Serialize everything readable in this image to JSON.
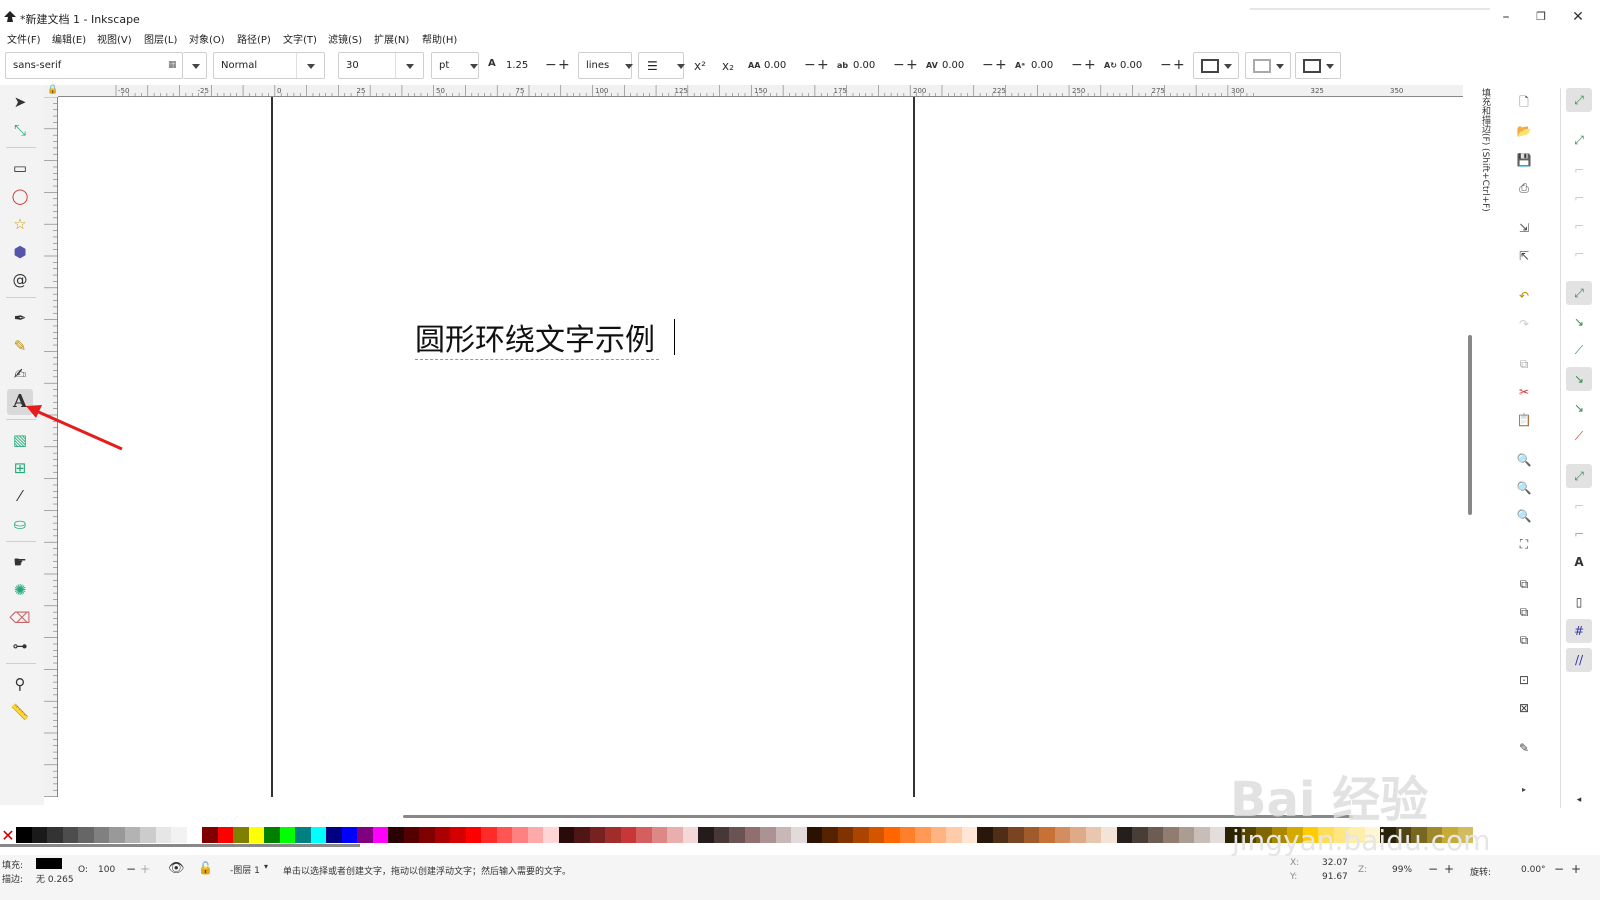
{
  "window": {
    "title": "*新建文档 1 - Inkscape",
    "minimize": "–",
    "restore": "❐",
    "close": "✕"
  },
  "menu": [
    "文件(F)",
    "编辑(E)",
    "视图(V)",
    "图层(L)",
    "对象(O)",
    "路径(P)",
    "文字(T)",
    "滤镜(S)",
    "扩展(N)",
    "帮助(H)"
  ],
  "text_toolbar": {
    "font_family": "sans-serif",
    "font_style": "Normal",
    "font_size": "30",
    "unit": "pt",
    "line_height": "1.25",
    "line_height_unit": "lines",
    "letter_spacing": "0.00",
    "word_spacing": "0.00",
    "kerning": "0.00",
    "vertical_shift": "0.00",
    "rotation": "0.00"
  },
  "rulers": {
    "top_labels": [
      "-50",
      "-25",
      "0",
      "25",
      "50",
      "75",
      "100",
      "125",
      "150",
      "175",
      "200",
      "225",
      "250",
      "275",
      "300",
      "325",
      "350"
    ]
  },
  "canvas": {
    "text": "圆形环绕文字示例"
  },
  "dock": {
    "fill_stroke_tab": "填充和描边(F) (Shift+Ctrl+F)"
  },
  "palette": {
    "colors": [
      "#000000",
      "#1a1a1a",
      "#333333",
      "#4d4d4d",
      "#666666",
      "#808080",
      "#999999",
      "#b3b3b3",
      "#cccccc",
      "#e6e6e6",
      "#f2f2f2",
      "#ffffff",
      "#800000",
      "#ff0000",
      "#808000",
      "#ffff00",
      "#008000",
      "#00ff00",
      "#008080",
      "#00ffff",
      "#000080",
      "#0000ff",
      "#800080",
      "#ff00ff",
      "#2b0000",
      "#550000",
      "#800000",
      "#aa0000",
      "#d40000",
      "#ff0000",
      "#ff2a2a",
      "#ff5555",
      "#ff8080",
      "#ffaaaa",
      "#ffd5d5",
      "#280b0b",
      "#501616",
      "#782121",
      "#a02c2c",
      "#c83737",
      "#d35f5f",
      "#de8787",
      "#e9afaf",
      "#f4d7d7",
      "#241c1c",
      "#483737",
      "#6c5353",
      "#916f6f",
      "#ac9393",
      "#c8b7b7",
      "#e3dbdb",
      "#2b1100",
      "#552200",
      "#803300",
      "#aa4400",
      "#d45500",
      "#ff6600",
      "#ff7f2a",
      "#ff9955",
      "#ffb380",
      "#ffccaa",
      "#ffe6d5",
      "#28170b",
      "#502d16",
      "#784421",
      "#a05a2c",
      "#c87137",
      "#d38d5f",
      "#deaa87",
      "#e9c6af",
      "#f4e3d7",
      "#241f1c",
      "#483e37",
      "#6c5d53",
      "#917c6f",
      "#ac9d93",
      "#c8beb7",
      "#e3dedb",
      "#2b2200",
      "#554400",
      "#806600",
      "#aa8800",
      "#d4aa00",
      "#ffcc00",
      "#ffdd55",
      "#ffe680",
      "#ffeeaa",
      "#fff6d5",
      "#28220b",
      "#504416",
      "#786721",
      "#a0892c",
      "#c8ab37",
      "#d3bc5f"
    ]
  },
  "status": {
    "fill_label": "填充:",
    "stroke_label": "描边:",
    "stroke_value": "无 0.265",
    "opacity_label": "O:",
    "opacity_value": "100",
    "layer": "-图层 1",
    "message": "单击以选择或者创建文字，拖动以创建浮动文字；然后输入需要的文字。",
    "x_label": "X:",
    "x_value": "32.07",
    "y_label": "Y:",
    "y_value": "91.67",
    "zoom_label": "Z:",
    "zoom_value": "99%",
    "rotate_label": "旋转:",
    "rotate_value": "0.00°"
  },
  "watermark": {
    "line1": "Bai 经验",
    "line2": "jingyan.baidu.com"
  }
}
